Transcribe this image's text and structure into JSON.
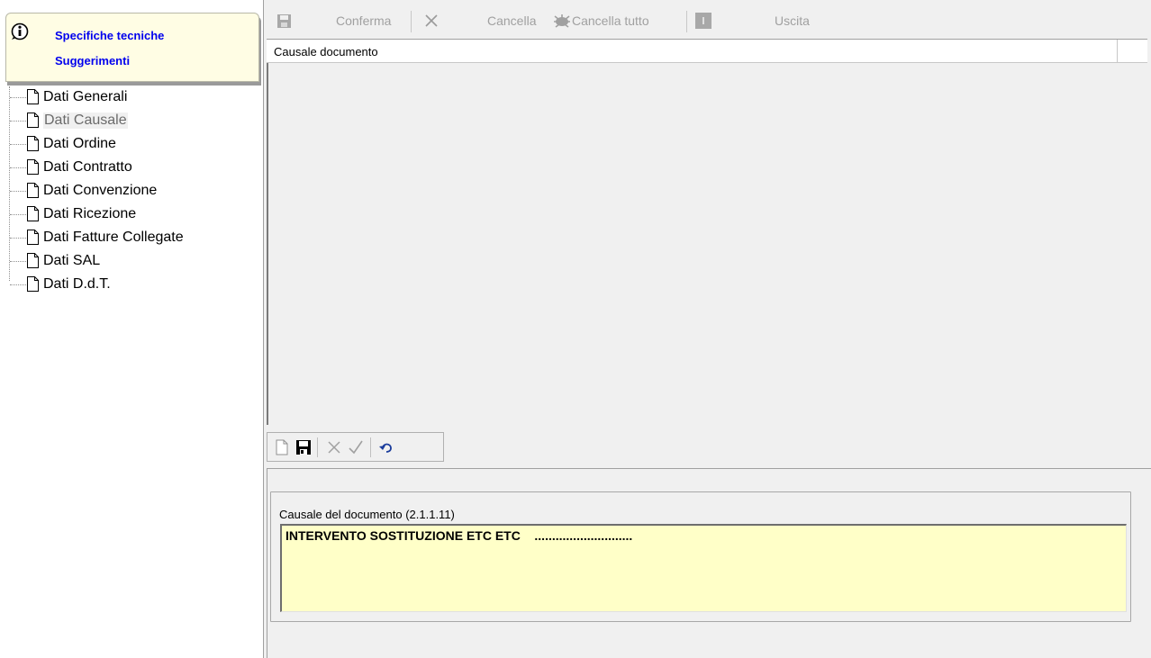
{
  "info_panel": {
    "icon": "info-icon",
    "link1": "Specifiche tecniche",
    "link2": "Suggerimenti"
  },
  "tree": {
    "items": [
      {
        "label": "Dati Generali"
      },
      {
        "label": "Dati Causale",
        "selected": true
      },
      {
        "label": "Dati Ordine"
      },
      {
        "label": "Dati Contratto"
      },
      {
        "label": "Dati Convenzione"
      },
      {
        "label": "Dati Ricezione"
      },
      {
        "label": "Dati Fatture Collegate"
      },
      {
        "label": "Dati SAL"
      },
      {
        "label": "Dati D.d.T."
      }
    ]
  },
  "toolbar": {
    "confirm_label": "Conferma",
    "cancel_label": "Cancella",
    "cancel_all_label": "Cancella tutto",
    "exit_label": "Uscita",
    "disabled_color": "#a0a0a0"
  },
  "grid": {
    "columns": [
      "Causale documento"
    ],
    "rows": []
  },
  "form": {
    "field_label": "Causale del documento (2.1.1.11)",
    "field_value": "INTERVENTO SOSTITUZIONE ETC ETC    ............................",
    "field_bg": "#ffffc8"
  }
}
